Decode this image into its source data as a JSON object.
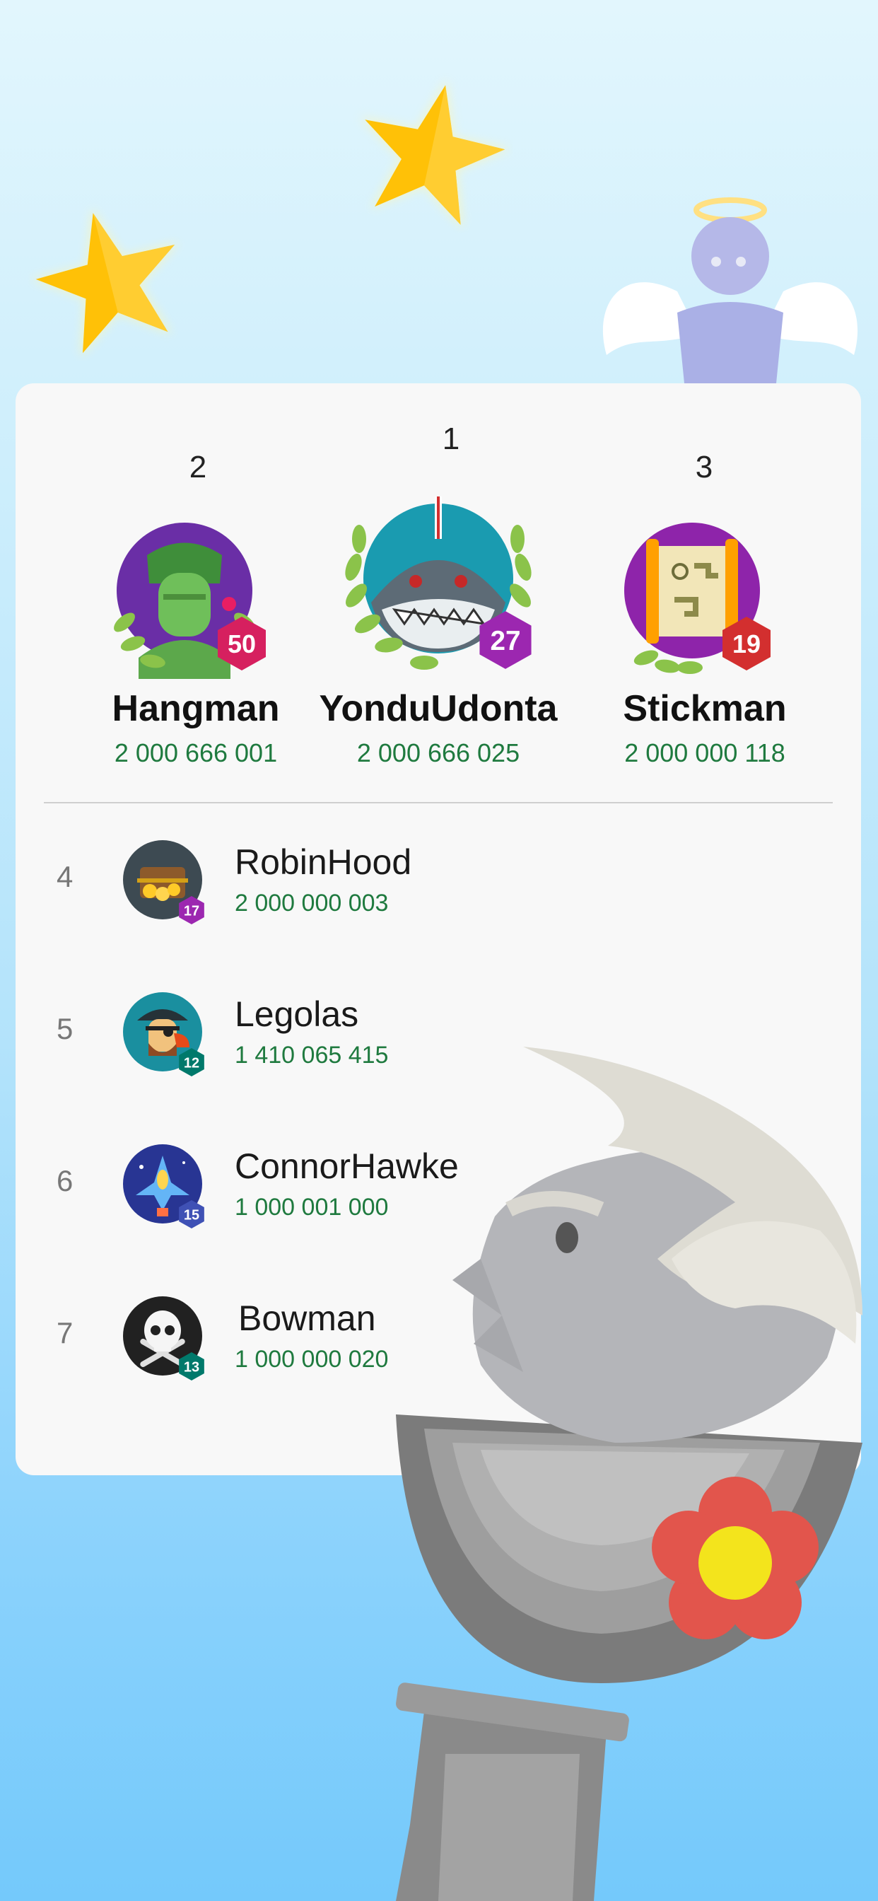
{
  "podium": [
    {
      "rank": "2",
      "name": "Hangman",
      "score": "2 000 666 001",
      "level": "50",
      "badge_color": "#d6205f",
      "ring_color": "#6a2ea6"
    },
    {
      "rank": "1",
      "name": "YonduUdonta",
      "score": "2 000 666 025",
      "level": "27",
      "badge_color": "#9c27b0",
      "ring_color": "#1a8fa4"
    },
    {
      "rank": "3",
      "name": "Stickman",
      "score": "2 000 000 118",
      "level": "19",
      "badge_color": "#d32f2f",
      "ring_color": "#8e24aa"
    }
  ],
  "list": [
    {
      "rank": "4",
      "name": "RobinHood",
      "score": "2 000 000 003",
      "level": "17",
      "badge_color": "#9c27b0"
    },
    {
      "rank": "5",
      "name": "Legolas",
      "score": "1 410 065 415",
      "level": "12",
      "badge_color": "#00796b"
    },
    {
      "rank": "6",
      "name": "ConnorHawke",
      "score": "1 000 001 000",
      "level": "15",
      "badge_color": "#3f51b5"
    },
    {
      "rank": "7",
      "name": "Bowman",
      "score": "1 000 000 020",
      "level": "13",
      "badge_color": "#00796b"
    }
  ],
  "colors": {
    "score_green": "#1f7a3f",
    "card_bg": "#f8f8f8"
  },
  "icons": [
    "star-icon",
    "angel-icon",
    "soldier-avatar-icon",
    "shark-avatar-icon",
    "map-avatar-icon",
    "treasure-avatar-icon",
    "pirate-avatar-icon",
    "spaceship-avatar-icon",
    "skull-avatar-icon",
    "statue-icon",
    "flower-icon"
  ]
}
